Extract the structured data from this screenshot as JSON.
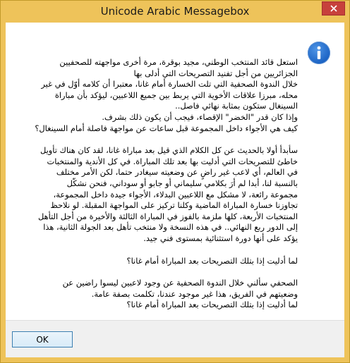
{
  "window": {
    "title": "Unicode Arabic Messagebox",
    "close_label": "✕"
  },
  "icon": {
    "name": "info-icon",
    "color": "#1b63c4"
  },
  "message": {
    "paragraphs": [
      [
        "استعل قائد المنتخب الوطني، مجيد بوقرة، مرة أخرى مواجهته للصحفيين",
        "الجزائريين من أجل تفنيد التصريحات التي أدلى بها",
        "خلال الندوة الصحفية التي تلت الخسارة أمام غانا، معتبرا أن كلامه أوّل في غير",
        "محله، مبرزا علاقات الأخوية التي يربط بين جميع اللاعبين، ليؤكد بأن مباراة",
        "السينغال ستكون بمثابة نهائي فاصل..",
        "وإذا كان قدر \"الخضر\" الإقصاء، فيجب أن يكون ذلك بشرف.",
        "كيف هي الأجواء داخل المجموعة قبل ساعات عن مواجهة فاصلة أمام السينغال؟"
      ],
      [
        "سأبدأ أولا بالحديث عن كل الكلام الذي قيل بعد مباراة غانا، لقد كان هناك تأويل",
        "خاطئ للتصريحات التي أدليت بها بعد تلك المباراة. في كل الأندية والمنتخبات",
        "في العالم، أي لاعب غير راضٍ عن وضعيته سيغادر حتما، لكن الأمر مختلف",
        "بالنسبة لنا، أبدا لم أرَ بكلامي سليماني أو جابو أو سوداني، فنحن نشكّل",
        "مجموعة رائعة، لا مشكل مع اللاعبين البدلاء، الأجواء جيدة داخل المجموعة،",
        "تجاوزنا خسارة المباراة الماضية وكلنا تركيز على المواجهة المقبلة. لو نلاحظ",
        "المنتخبات الأربعة، كلها ملزمة بالفوز في المباراة الثالثة والأخيرة من أجل التأهل",
        "إلى الدور ربع النهائي.. في هذه النسخة ولا منتخب تأهل بعد الجولة الثانية، هذا",
        "يؤكد على أنها دورة استثنائية بمستوى فني جيد."
      ],
      [
        "لما أدليت إذا بتلك التصريحات بعد المباراة أمام غانا؟"
      ],
      [
        "الصحفي سألني خلال الندوة الصحفية عن وجود لاعبين ليسوا راضين عن",
        "وضعيتهم في الفريق، هذا غير موجود عندنا، تكلمت بصفة عامة.",
        "لما أدليت إذا بتلك التصريحات بعد المباراة أمام غانا؟"
      ]
    ]
  },
  "buttons": {
    "ok_label": "OK"
  }
}
